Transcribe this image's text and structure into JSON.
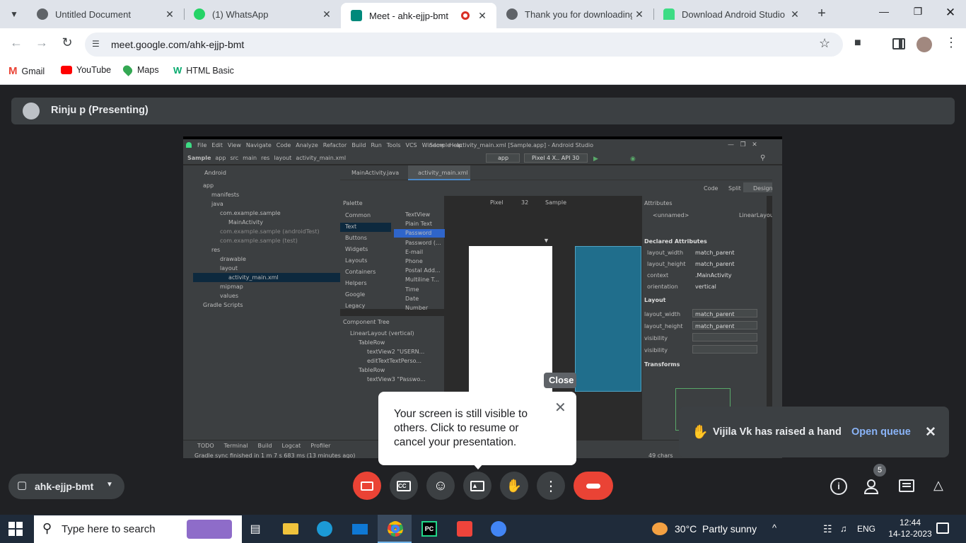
{
  "browser": {
    "tabs": [
      {
        "title": "Untitled Document",
        "favicon_color": "#5f6368"
      },
      {
        "title": "(1) WhatsApp",
        "favicon_color": "#25d366"
      },
      {
        "title": "Meet - ahk-ejjp-bmt",
        "favicon_color": "#00897b"
      },
      {
        "title": "Thank you for downloading",
        "favicon_color": "#5f6368"
      },
      {
        "title": "Download Android Studio &",
        "favicon_color": "#3ddc84"
      }
    ],
    "url": "meet.google.com/ahk-ejjp-bmt",
    "bookmarks": [
      {
        "label": "Gmail",
        "icon": "gmail-icon"
      },
      {
        "label": "YouTube",
        "icon": "youtube-icon"
      },
      {
        "label": "Maps",
        "icon": "maps-icon"
      },
      {
        "label": "HTML Basic",
        "icon": "w3-icon"
      }
    ]
  },
  "meet": {
    "presenter": "Rinju p (Presenting)",
    "meeting_code": "ahk-ejjp-bmt",
    "close_tooltip": "Close",
    "screen_popup": "Your screen is still visible to others. Click to resume or cancel your presentation.",
    "hand_notification": "Vijila Vk has raised a hand",
    "open_queue": "Open queue",
    "participant_count": "5",
    "accent_red": "#ea4335",
    "accent_blue": "#8ab4f8"
  },
  "android_studio": {
    "title": "Sample - activity_main.xml [Sample.app] - Android Studio",
    "menu": [
      "File",
      "Edit",
      "View",
      "Navigate",
      "Code",
      "Analyze",
      "Refactor",
      "Build",
      "Run",
      "Tools",
      "VCS",
      "Window",
      "Help"
    ],
    "breadcrumb": [
      "Sample",
      "app",
      "src",
      "main",
      "res",
      "layout",
      "activity_main.xml"
    ],
    "run_config": "app",
    "device": "Pixel 4 X.. API 30",
    "project_view": "Android",
    "editor_tabs": [
      "MainActivity.java",
      "activity_main.xml"
    ],
    "view_modes": [
      "Code",
      "Split",
      "Design"
    ],
    "project_tree": [
      {
        "label": "app",
        "depth": 0
      },
      {
        "label": "manifests",
        "depth": 1
      },
      {
        "label": "java",
        "depth": 1
      },
      {
        "label": "com.example.sample",
        "depth": 2
      },
      {
        "label": "MainActivity",
        "depth": 3
      },
      {
        "label": "com.example.sample (androidTest)",
        "depth": 2
      },
      {
        "label": "com.example.sample (test)",
        "depth": 2
      },
      {
        "label": "res",
        "depth": 1
      },
      {
        "label": "drawable",
        "depth": 2
      },
      {
        "label": "layout",
        "depth": 2
      },
      {
        "label": "activity_main.xml",
        "depth": 3
      },
      {
        "label": "mipmap",
        "depth": 2
      },
      {
        "label": "values",
        "depth": 2
      },
      {
        "label": "Gradle Scripts",
        "depth": 0
      }
    ],
    "palette_title": "Palette",
    "palette_categories": [
      "Common",
      "Text",
      "Buttons",
      "Widgets",
      "Layouts",
      "Containers",
      "Helpers",
      "Google",
      "Legacy"
    ],
    "palette_items": [
      "TextView",
      "Plain Text",
      "Password",
      "Password (...",
      "E-mail",
      "Phone",
      "Postal Add...",
      "Multiline T...",
      "Time",
      "Date",
      "Number"
    ],
    "design_toolbar": {
      "device": "Pixel",
      "api": "32",
      "theme": "Sample"
    },
    "component_tree_title": "Component Tree",
    "component_tree": [
      "LinearLayout (vertical)",
      "TableRow",
      "textView2 \"USERN...",
      "editTextTextPerso...",
      "TableRow",
      "textView3 \"Passwo..."
    ],
    "attributes_title": "Attributes",
    "attr_unnamed": "<unnamed>",
    "attr_class": "LinearLayout",
    "declared_section": "Declared Attributes",
    "declared": [
      {
        "name": "layout_width",
        "value": "match_parent"
      },
      {
        "name": "layout_height",
        "value": "match_parent"
      },
      {
        "name": "context",
        "value": ".MainActivity"
      },
      {
        "name": "orientation",
        "value": "vertical"
      }
    ],
    "layout_section": "Layout",
    "layout_attrs": [
      {
        "name": "layout_width",
        "value": "match_parent"
      },
      {
        "name": "layout_height",
        "value": "match_parent"
      },
      {
        "name": "visibility",
        "value": ""
      },
      {
        "name": "visibility",
        "value": ""
      }
    ],
    "transforms_section": "Transforms",
    "bottom_tabs": [
      "TODO",
      "Terminal",
      "Build",
      "Logcat",
      "Profiler"
    ],
    "status": "Gradle sync finished in 1 m 7 s 683 ms (13 minutes ago)",
    "chars": "49 chars"
  },
  "taskbar": {
    "search_placeholder": "Type here to search",
    "weather": "30°C  Partly sunny",
    "lang": "ENG",
    "time": "12:44",
    "date": "14-12-2023"
  }
}
